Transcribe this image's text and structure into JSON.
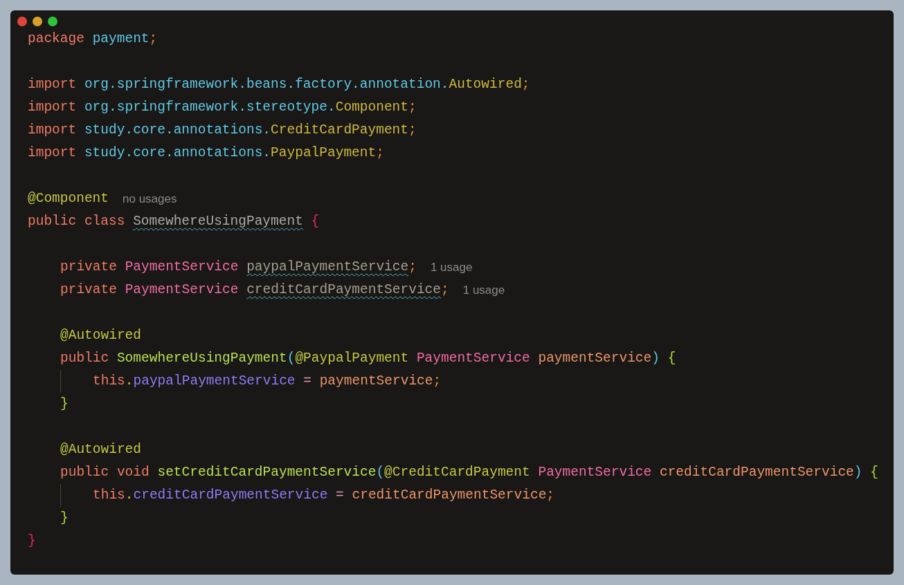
{
  "window": {
    "controls": [
      {
        "kind": "close"
      },
      {
        "kind": "minimize"
      },
      {
        "kind": "zoom"
      }
    ]
  },
  "lines": [
    {
      "kind": "top",
      "tokens": [
        {
          "kind": "keyword",
          "text": "package "
        },
        {
          "kind": "pkg",
          "text": "payment"
        },
        {
          "kind": "semi",
          "text": ";"
        }
      ]
    },
    {
      "kind": "blank"
    },
    {
      "kind": "top",
      "tokens": [
        {
          "kind": "keyword",
          "text": "import "
        },
        {
          "kind": "pkg",
          "text": "org.springframework.beans.factory.annotation."
        },
        {
          "kind": "cls",
          "text": "Autowired"
        },
        {
          "kind": "semi",
          "text": ";"
        }
      ]
    },
    {
      "kind": "top",
      "tokens": [
        {
          "kind": "keyword",
          "text": "import "
        },
        {
          "kind": "pkg",
          "text": "org.springframework.stereotype."
        },
        {
          "kind": "cls",
          "text": "Component"
        },
        {
          "kind": "semi",
          "text": ";"
        }
      ]
    },
    {
      "kind": "top",
      "tokens": [
        {
          "kind": "keyword",
          "text": "import "
        },
        {
          "kind": "pkg",
          "text": "study.core.annotations."
        },
        {
          "kind": "cls",
          "text": "CreditCardPayment"
        },
        {
          "kind": "semi",
          "text": ";"
        }
      ]
    },
    {
      "kind": "top",
      "tokens": [
        {
          "kind": "keyword",
          "text": "import "
        },
        {
          "kind": "pkg",
          "text": "study.core.annotations."
        },
        {
          "kind": "cls",
          "text": "PaypalPayment"
        },
        {
          "kind": "semi",
          "text": ";"
        }
      ]
    },
    {
      "kind": "blank"
    },
    {
      "kind": "top",
      "tokens": [
        {
          "kind": "annotation",
          "text": "@Component"
        }
      ],
      "hint": "no usages"
    },
    {
      "kind": "top",
      "tokens": [
        {
          "kind": "keyword",
          "text": "public class "
        },
        {
          "kind": "unused",
          "text": "SomewhereUsingPayment"
        },
        {
          "kind": "outer-brace",
          "text": " {"
        }
      ]
    },
    {
      "kind": "blank"
    },
    {
      "kind": "member",
      "tokens": [
        {
          "kind": "keyword",
          "text": "private "
        },
        {
          "kind": "type",
          "text": "PaymentService "
        },
        {
          "kind": "unused-field",
          "text": "paypalPaymentService"
        },
        {
          "kind": "semi",
          "text": ";"
        }
      ],
      "hint": "1 usage"
    },
    {
      "kind": "member",
      "tokens": [
        {
          "kind": "keyword",
          "text": "private "
        },
        {
          "kind": "type",
          "text": "PaymentService "
        },
        {
          "kind": "unused-field",
          "text": "creditCardPaymentService"
        },
        {
          "kind": "semi",
          "text": ";"
        }
      ],
      "hint": "1 usage"
    },
    {
      "kind": "blank"
    },
    {
      "kind": "member",
      "tokens": [
        {
          "kind": "annotation",
          "text": "@Autowired"
        }
      ]
    },
    {
      "kind": "member",
      "tokens": [
        {
          "kind": "keyword",
          "text": "public "
        },
        {
          "kind": "method",
          "text": "SomewhereUsingPayment"
        },
        {
          "kind": "paren",
          "text": "("
        },
        {
          "kind": "annotation",
          "text": "@PaypalPayment "
        },
        {
          "kind": "type",
          "text": "PaymentService "
        },
        {
          "kind": "param",
          "text": "paymentService"
        },
        {
          "kind": "paren",
          "text": ")"
        },
        {
          "kind": "brace",
          "text": " {"
        }
      ]
    },
    {
      "kind": "body",
      "tokens": [
        {
          "kind": "keyword",
          "text": "this"
        },
        {
          "kind": "dot",
          "text": "."
        },
        {
          "kind": "field",
          "text": "paypalPaymentService"
        },
        {
          "kind": "op",
          "text": " = "
        },
        {
          "kind": "param",
          "text": "paymentService"
        },
        {
          "kind": "semi",
          "text": ";"
        }
      ]
    },
    {
      "kind": "member",
      "tokens": [
        {
          "kind": "brace",
          "text": "}"
        }
      ]
    },
    {
      "kind": "blank"
    },
    {
      "kind": "member",
      "tokens": [
        {
          "kind": "annotation",
          "text": "@Autowired"
        }
      ]
    },
    {
      "kind": "member",
      "tokens": [
        {
          "kind": "keyword",
          "text": "public void "
        },
        {
          "kind": "method",
          "text": "setCreditCardPaymentService"
        },
        {
          "kind": "paren",
          "text": "("
        },
        {
          "kind": "annotation",
          "text": "@CreditCardPayment "
        },
        {
          "kind": "type",
          "text": "PaymentService "
        },
        {
          "kind": "param",
          "text": "creditCardPaymentService"
        },
        {
          "kind": "paren",
          "text": ")"
        },
        {
          "kind": "brace",
          "text": " {"
        }
      ]
    },
    {
      "kind": "body",
      "tokens": [
        {
          "kind": "keyword",
          "text": "this"
        },
        {
          "kind": "dot",
          "text": "."
        },
        {
          "kind": "field",
          "text": "creditCardPaymentService"
        },
        {
          "kind": "op",
          "text": " = "
        },
        {
          "kind": "param",
          "text": "creditCardPaymentService"
        },
        {
          "kind": "semi",
          "text": ";"
        }
      ]
    },
    {
      "kind": "member",
      "tokens": [
        {
          "kind": "brace",
          "text": "}"
        }
      ]
    },
    {
      "kind": "top",
      "tokens": [
        {
          "kind": "outer-brace",
          "text": "}"
        }
      ]
    }
  ]
}
